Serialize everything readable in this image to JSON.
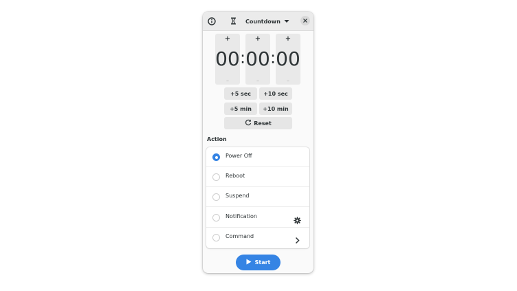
{
  "header": {
    "info_icon": "info-icon",
    "mode_icon": "hourglass-icon",
    "mode_label": "Countdown",
    "dropdown_icon": "caret-down-icon",
    "close_icon": "close-icon"
  },
  "timer": {
    "hours": "00",
    "minutes": "00",
    "seconds": "00",
    "separator": ":",
    "increment_glyph": "+",
    "decrement_glyph": "–"
  },
  "quick_add": {
    "plus_5_sec": "+5 sec",
    "plus_10_sec": "+10 sec",
    "plus_5_min": "+5 min",
    "plus_10_min": "+10 min",
    "reset_label": "Reset",
    "reset_icon": "reset-icon"
  },
  "action": {
    "title": "Action",
    "options": [
      {
        "label": "Power Off",
        "checked": true
      },
      {
        "label": "Reboot",
        "checked": false
      },
      {
        "label": "Suspend",
        "checked": false
      },
      {
        "label": "Notification",
        "checked": false,
        "suffix_icon": "gear-icon"
      },
      {
        "label": "Command",
        "checked": false,
        "suffix_icon": "chevron-right-icon"
      }
    ]
  },
  "start": {
    "label": "Start",
    "icon": "play-icon"
  },
  "colors": {
    "accent": "#3584e4",
    "window_bg": "#fafafa",
    "header_bg": "#ebebeb",
    "button_bg": "#e6e6e6",
    "text": "#2e3436"
  }
}
